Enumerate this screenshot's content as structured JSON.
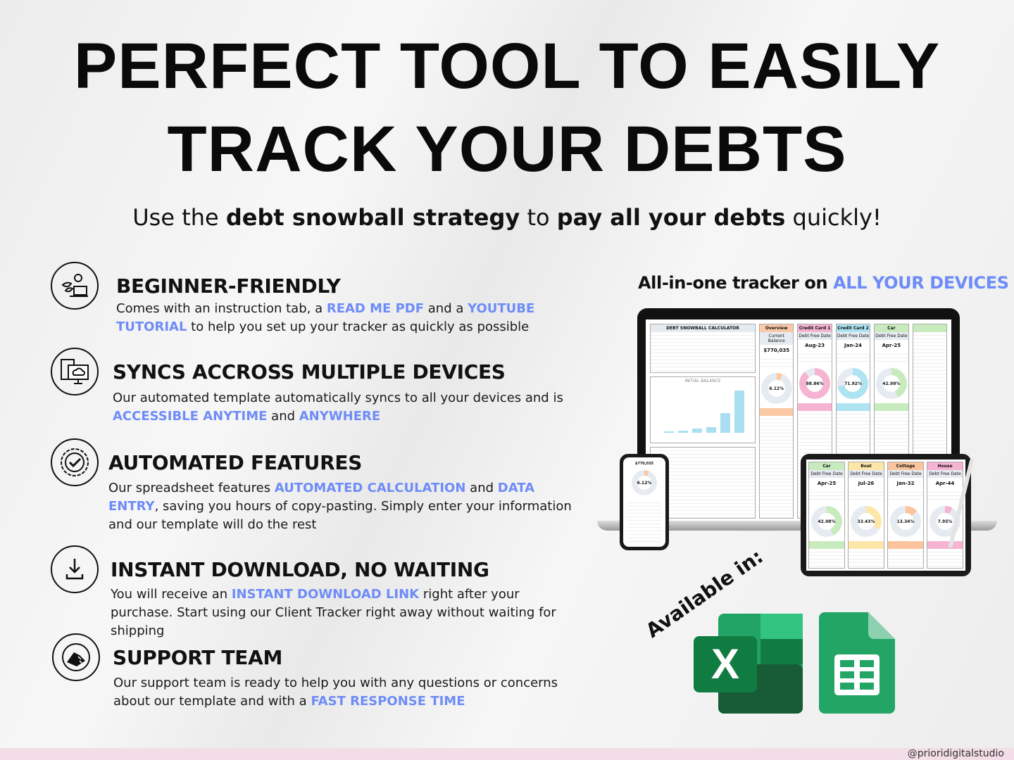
{
  "headline": {
    "line1": "PERFECT TOOL TO EASILY",
    "line2": "TRACK YOUR DEBTS"
  },
  "subtitle": {
    "p1": "Use the ",
    "b1": "debt snowball strategy",
    "p2": " to ",
    "b2": "pay all your debts",
    "p3": " quickly!"
  },
  "features": [
    {
      "icon": "person-laptop-plant-icon",
      "title": "BEGINNER-FRIENDLY",
      "parts": [
        "Comes with an instruction tab, a ",
        "READ ME PDF",
        " and a ",
        "YOUTUBE TUTORIAL",
        " to help you set up your tracker as quickly as possible"
      ]
    },
    {
      "icon": "devices-sync-cloud-icon",
      "title": "SYNCS ACCROSS MULTIPLE DEVICES",
      "parts": [
        "Our automated template automatically syncs to all your devices and is ",
        "ACCESSIBLE ANYTIME",
        " and ",
        "ANYWHERE",
        ""
      ]
    },
    {
      "icon": "gear-check-icon",
      "title": "AUTOMATED FEATURES",
      "parts": [
        "Our spreadsheet features ",
        "AUTOMATED CALCULATION",
        " and ",
        "DATA ENTRY",
        ", saving you hours of copy-pasting. Simply enter your information and our template will do the rest"
      ]
    },
    {
      "icon": "download-icon",
      "title": "INSTANT DOWNLOAD, NO WAITING",
      "parts": [
        "You will receive an ",
        "INSTANT DOWNLOAD LINK",
        " right after your purchase. Start using our Client Tracker right away without waiting for shipping",
        "",
        ""
      ]
    },
    {
      "icon": "handshake-support-icon",
      "title": "SUPPORT TEAM",
      "parts": [
        "Our support team is ready to help you with any questions or concerns about our template and with a ",
        "FAST RESPONSE TIME",
        "",
        "",
        ""
      ]
    }
  ],
  "devices": {
    "tag_prefix": "All-in-one tracker on ",
    "tag_highlight": "ALL YOUR DEVICES"
  },
  "laptop": {
    "calc_title": "DEBT SNOWBALL CALCULATOR",
    "chart_title": "INITIAL BALANCE",
    "cards": [
      {
        "name": "Overview",
        "label": "Current Balance",
        "value": "$770,035",
        "pct": "6.12%",
        "pct_value": 6.12,
        "color": "#fbc9a6"
      },
      {
        "name": "Credit Card 1",
        "label": "Debt Free Date",
        "value": "Aug-23",
        "pct": "88.86%",
        "pct_value": 88.86,
        "color": "#f6b3d2"
      },
      {
        "name": "Credit Card 2",
        "label": "Debt Free Date",
        "value": "Jan-24",
        "pct": "71.92%",
        "pct_value": 71.92,
        "color": "#aee3f1"
      },
      {
        "name": "Car",
        "label": "Debt Free Date",
        "value": "Apr-25",
        "pct": "42.98%",
        "pct_value": 42.98,
        "color": "#c8ebbd"
      }
    ]
  },
  "tablet": {
    "cards": [
      {
        "name": "Car",
        "label": "Debt Free Date",
        "value": "Apr-25",
        "pct": "42.98%",
        "pct_value": 42.98,
        "color": "#c8ebbd"
      },
      {
        "name": "Boat",
        "label": "Debt Free Date",
        "value": "Jul-26",
        "pct": "33.43%",
        "pct_value": 33.43,
        "color": "#fde7a8"
      },
      {
        "name": "Cottage",
        "label": "Debt Free Date",
        "value": "Jan-32",
        "pct": "13.34%",
        "pct_value": 13.34,
        "color": "#fbc49c"
      },
      {
        "name": "House",
        "label": "Debt Free Date",
        "value": "Apr-44",
        "pct": "7.95%",
        "pct_value": 7.95,
        "color": "#f6b3d2"
      }
    ]
  },
  "phone": {
    "value": "$770,035",
    "pct": "6.12%",
    "pct_value": 6.12
  },
  "available": {
    "label": "Available in:",
    "apps": [
      "excel-icon",
      "google-sheets-icon"
    ],
    "excel_letter": "X"
  },
  "footer": {
    "handle": "@prioridigitalstudio"
  },
  "colors": {
    "accent": "#6e8cf7",
    "excel": "#1d7a45",
    "sheets": "#21a464",
    "footer": "#f3dde6"
  }
}
